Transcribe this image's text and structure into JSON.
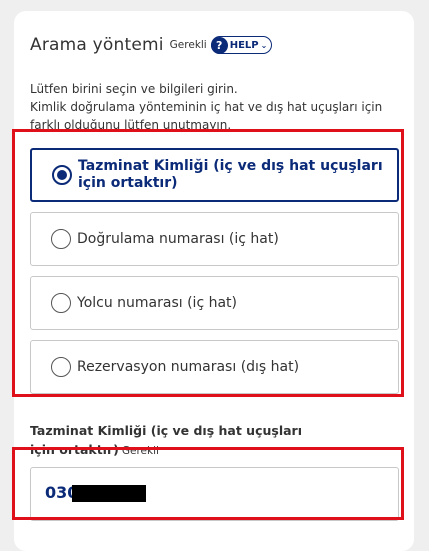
{
  "section": {
    "title": "Arama yöntemi",
    "required": "Gerekli",
    "help_label": "HELP",
    "help_icon": "question-icon",
    "help_chevron": "chevron-down-icon"
  },
  "instructions": {
    "line1": "Lütfen birini seçin ve bilgileri girin.",
    "line2": "Kimlik doğrulama yönteminin iç hat ve dış hat uçuşları için farklı olduğunu lütfen unutmayın."
  },
  "options": [
    {
      "label": "Tazminat Kimliği (iç ve dış hat uçuşları için ortaktır)",
      "selected": true
    },
    {
      "label": "Doğrulama numarası (iç hat)",
      "selected": false
    },
    {
      "label": "Yolcu numarası (iç hat)",
      "selected": false
    },
    {
      "label": "Rezervasyon numarası (dış hat)",
      "selected": false
    }
  ],
  "field": {
    "label": "Tazminat Kimliği (iç ve dış hat uçuşları için ortaktır)",
    "required": "Gerekli",
    "value": "030"
  },
  "colors": {
    "accent": "#0b2a78",
    "highlight": "#e0101b"
  }
}
